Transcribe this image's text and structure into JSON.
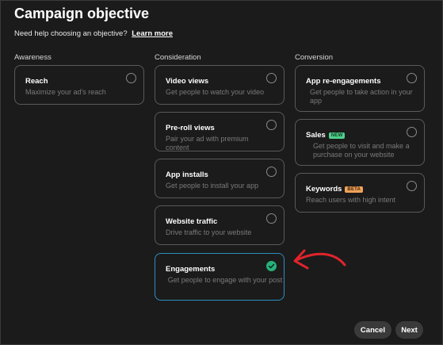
{
  "header": {
    "title": "Campaign objective",
    "help_text": "Need help choosing an objective?",
    "help_link": "Learn more"
  },
  "columns": [
    {
      "heading": "Awareness",
      "cards": [
        {
          "title": "Reach",
          "desc": "Maximize your ad's reach",
          "selected": false
        }
      ]
    },
    {
      "heading": "Consideration",
      "cards": [
        {
          "title": "Video views",
          "desc": "Get people to watch your video",
          "selected": false
        },
        {
          "title": "Pre-roll views",
          "desc": "Pair your ad with premium content",
          "selected": false
        },
        {
          "title": "App installs",
          "desc": "Get people to install your app",
          "selected": false
        },
        {
          "title": "Website traffic",
          "desc": "Drive traffic to your website",
          "selected": false
        },
        {
          "title": "Engagements",
          "desc": "Get people to engage with your post",
          "selected": true
        }
      ]
    },
    {
      "heading": "Conversion",
      "cards": [
        {
          "title": "App re-engagements",
          "desc": "Get people to take action in your app",
          "selected": false
        },
        {
          "title": "Sales",
          "badge": "NEW",
          "desc": "Get people to visit and make a purchase on your website",
          "selected": false
        },
        {
          "title": "Keywords",
          "badge": "BETA",
          "desc": "Reach users with high intent",
          "selected": false
        }
      ]
    }
  ],
  "footer": {
    "cancel_label": "Cancel",
    "next_label": "Next"
  },
  "colors": {
    "selected_border": "#2c8fbf",
    "check": "#27b07a",
    "arrow": "#e0242c"
  },
  "icons": {
    "unselected": "radio-icon",
    "selected": "check-circle-icon",
    "annotation": "red-arrow-icon"
  }
}
